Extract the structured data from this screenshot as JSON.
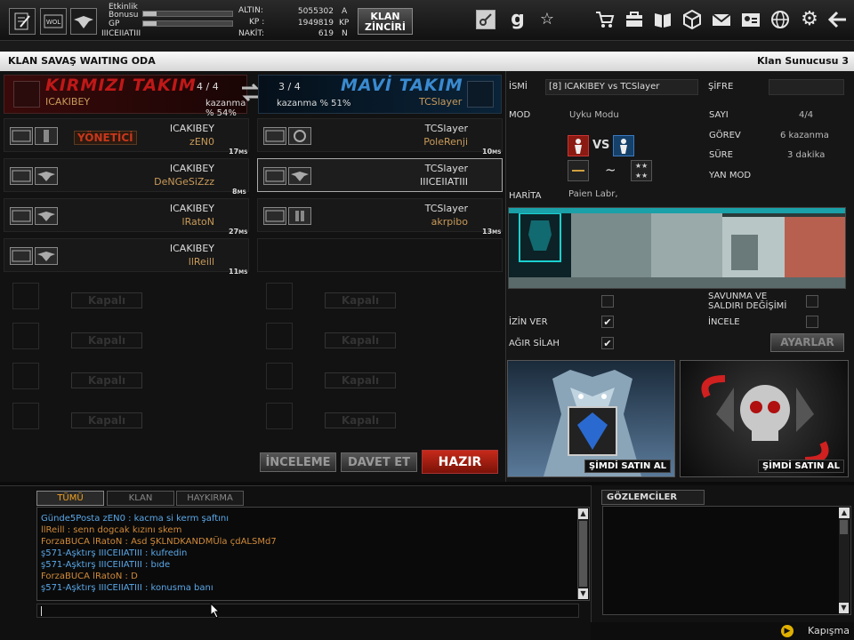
{
  "topbar": {
    "stat_labels": [
      "Etkinlik",
      "Bonusu",
      "GP"
    ],
    "username": "IIICEIIATIII",
    "gp_progress": 0.15,
    "bonus_progress": 0.15,
    "currencies": [
      {
        "label": "ALTIN:",
        "value": "5055302",
        "unit": "A"
      },
      {
        "label": "KP :",
        "value": "1949819",
        "unit": "KP"
      },
      {
        "label": "NAKİT:",
        "value": "619",
        "unit": "N"
      }
    ],
    "klan_button": {
      "line1": "KLAN",
      "line2": "ZİNCİRİ"
    },
    "icons": [
      "key-icon",
      "g-icon",
      "star-icon",
      "cart-icon",
      "inventory-icon",
      "book-icon",
      "cube-icon",
      "mail-icon",
      "profile-icon",
      "globe-icon",
      "gear-icon",
      "back-arrow-icon"
    ]
  },
  "room": {
    "title": "KLAN SAVAŞ WAITING ODA",
    "server": "Klan Sunucusu 3"
  },
  "teams": {
    "red": {
      "name": "KIRMIZI TAKIM",
      "count": "4 / 4",
      "clan": "ICAKIBEY",
      "winrate": "kazanma % 54%"
    },
    "blue": {
      "name": "MAVİ TAKIM",
      "count": "3 / 4",
      "clan": "TCSlayer",
      "winrate": "kazanma % 51%"
    }
  },
  "red_players": [
    {
      "clan": "ICAKIBEY",
      "name": "zEN0",
      "ping": "17",
      "ping_unit": "MS",
      "badge": "YÖNETİCİ"
    },
    {
      "clan": "ICAKIBEY",
      "name": "DeNGeSiZzz",
      "ping": "8",
      "ping_unit": "MS"
    },
    {
      "clan": "ICAKIBEY",
      "name": "lRatoN",
      "ping": "27",
      "ping_unit": "MS"
    },
    {
      "clan": "ICAKIBEY",
      "name": "llReill",
      "ping": "11",
      "ping_unit": "MS"
    }
  ],
  "blue_players": [
    {
      "clan": "TCSlayer",
      "name": "PoleRenji",
      "ping": "10",
      "ping_unit": "MS"
    },
    {
      "clan": "TCSlayer",
      "name": "IIICEIIATIII",
      "ping": "",
      "ping_unit": ""
    },
    {
      "clan": "TCSlayer",
      "name": "akrpibo",
      "ping": "13",
      "ping_unit": "MS"
    }
  ],
  "closed_label": "Kapalı",
  "buttons": {
    "inspect": "İNCELEME",
    "invite": "DAVET ET",
    "ready": "HAZIR"
  },
  "room_info": {
    "name_label": "İSMİ",
    "name_value": "[8] ICAKIBEY vs TCSlayer",
    "password_label": "ŞİFRE",
    "mode_label": "MOD",
    "mode_value": "Uyku Modu",
    "vs_label": "VS",
    "tilde": "~",
    "count_label": "SAYI",
    "count_value": "4/4",
    "mission_label": "GÖREV",
    "mission_value": "6 kazanma",
    "duration_label": "SÜRE",
    "duration_value": "3 dakika",
    "submode_label": "YAN MOD",
    "map_label": "HARİTA",
    "map_value": "Paien Labr,"
  },
  "options": {
    "allow_label": "İZİN VER",
    "allow_checked": true,
    "heavy_label": "AĞIR SİLAH",
    "heavy_checked": true,
    "swap_label_1": "SAVUNMA VE",
    "swap_label_2": "SALDIRI DEĞİŞİMİ",
    "inspect_label": "İNCELE",
    "settings_button": "AYARLAR"
  },
  "ads": [
    {
      "button": "ŞİMDİ SATIN AL"
    },
    {
      "button": "ŞİMDİ SATIN AL"
    }
  ],
  "chat": {
    "tabs": [
      "TÜMÜ",
      "KLAN",
      "HAYKIRMA"
    ],
    "active_tab": 0,
    "lines": [
      {
        "text": "Günde5Posta  zEN0 : kacma si kerm şaftını",
        "color": "#5aa8e8"
      },
      {
        "text": "llReill : senn dogcak kızını skem",
        "color": "#d08a3a"
      },
      {
        "text": "ForzaBUCA    lRatoN : Asd ŞKLNDKANDMÜla çdALSMd7",
        "color": "#d08a3a"
      },
      {
        "text": "ş571-Aşktırş IIICEIIATIII : kufredin",
        "color": "#5aa8e8"
      },
      {
        "text": "ş571-Aşktırş IIICEIIATIII : bıde",
        "color": "#5aa8e8"
      },
      {
        "text": "ForzaBUCA    lRatoN : D",
        "color": "#d08a3a"
      },
      {
        "text": "ş571-Aşktırş IIICEIIATIII : konusma banı",
        "color": "#5aa8e8"
      }
    ]
  },
  "observers": {
    "title": "GÖZLEMCİLER"
  },
  "footer": {
    "label": "Kapışma"
  }
}
